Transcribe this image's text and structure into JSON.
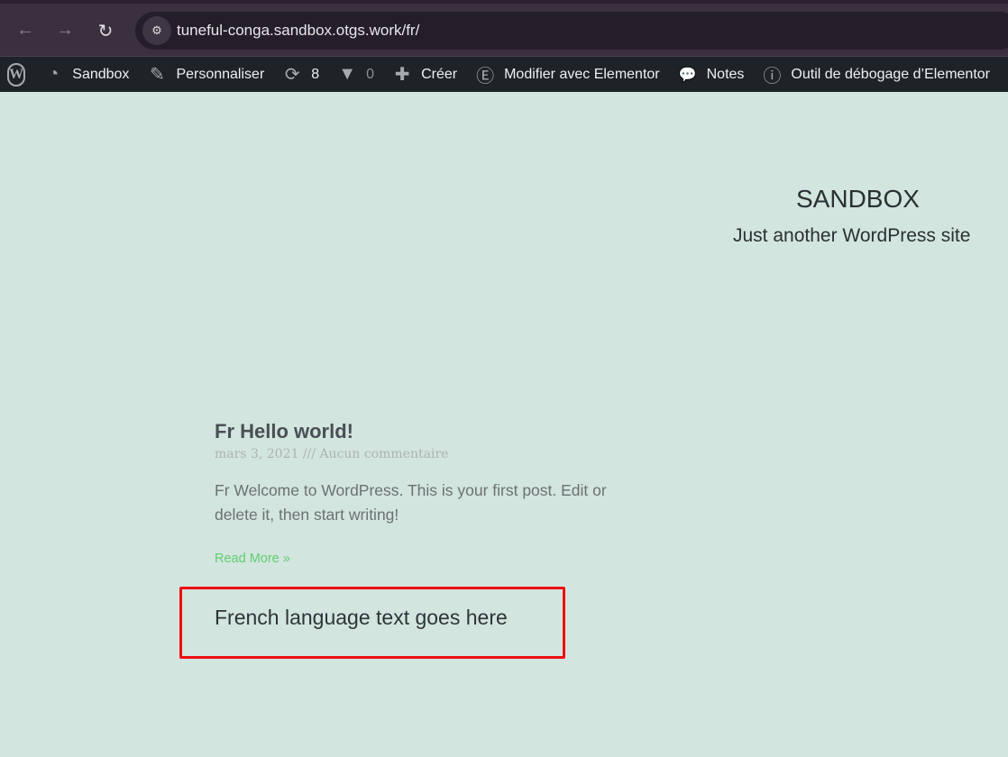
{
  "browser": {
    "url": "tuneful-conga.sandbox.otgs.work/fr/",
    "back_icon": "←",
    "forward_icon": "→",
    "reload_icon": "↻",
    "site_settings_icon": "⚙"
  },
  "admin_bar": {
    "wp_logo": "W",
    "items": [
      {
        "label": "Sandbox",
        "icon": "◔"
      },
      {
        "label": "Personnaliser",
        "icon": "✎"
      },
      {
        "label": "8",
        "icon": "⟳"
      },
      {
        "label": "0",
        "icon": "▼"
      },
      {
        "label": "Créer",
        "icon": "✚"
      },
      {
        "label": "Modifier avec Elementor",
        "icon": "Ⓔ"
      },
      {
        "label": "Notes",
        "icon": "💬"
      },
      {
        "label": "Outil de débogage d’Elementor",
        "icon": "ⓘ"
      }
    ]
  },
  "site": {
    "title": "SANDBOX",
    "tagline": "Just another WordPress site"
  },
  "post": {
    "title": "Fr Hello world!",
    "meta": "mars 3, 2021 /// Aucun commentaire",
    "excerpt": "Fr Welcome to WordPress. This is your first post. Edit or delete it, then start writing!",
    "read_more": "Read More »"
  },
  "highlight": {
    "text": "French language text goes here",
    "border_color": "#ee0f13"
  }
}
